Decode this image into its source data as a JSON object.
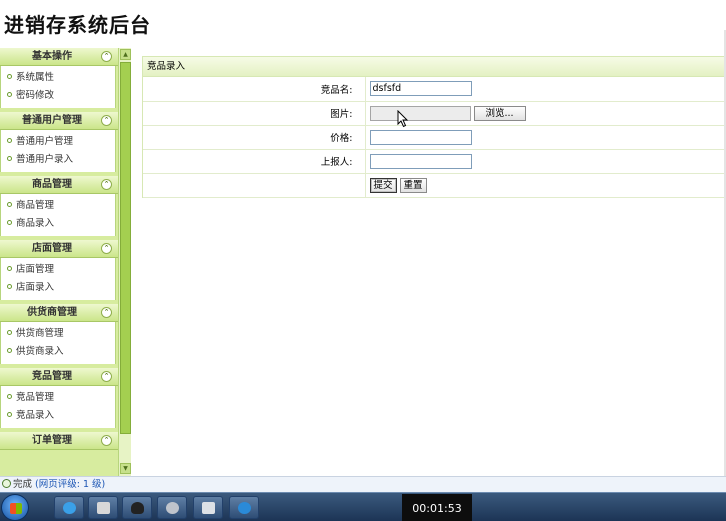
{
  "page": {
    "title": "进销存系统后台"
  },
  "sidebar": {
    "sections": [
      {
        "title": "基本操作",
        "items": [
          "系统属性",
          "密码修改"
        ]
      },
      {
        "title": "普通用户管理",
        "items": [
          "普通用户管理",
          "普通用户录入"
        ]
      },
      {
        "title": "商品管理",
        "items": [
          "商品管理",
          "商品录入"
        ]
      },
      {
        "title": "店面管理",
        "items": [
          "店面管理",
          "店面录入"
        ]
      },
      {
        "title": "供货商管理",
        "items": [
          "供货商管理",
          "供货商录入"
        ]
      },
      {
        "title": "竞品管理",
        "items": [
          "竞品管理",
          "竞品录入"
        ]
      },
      {
        "title": "订单管理",
        "items": []
      }
    ],
    "toggle_glyph": "⌃"
  },
  "form": {
    "panel_title": "竞品录入",
    "fields": {
      "name": {
        "label": "竞品名:",
        "value": "dsfsfd"
      },
      "image": {
        "label": "图片:",
        "browse_label": "浏览..."
      },
      "price": {
        "label": "价格:",
        "value": ""
      },
      "reporter": {
        "label": "上报人:",
        "value": ""
      }
    },
    "submit_label": "提交",
    "reset_label": "重置"
  },
  "statusbar": {
    "text": "完成",
    "level": "(网页评级: 1 级)"
  },
  "taskbar": {
    "clock": "00:01:53"
  },
  "colors": {
    "sidebar_bg": "#d7ec9f",
    "sidebar_header": "#cbe58a",
    "accent_green": "#a4cf50"
  },
  "icons": [
    "collapse-icon",
    "bullet-icon",
    "cursor-icon",
    "ie-icon",
    "windows-start-icon"
  ]
}
